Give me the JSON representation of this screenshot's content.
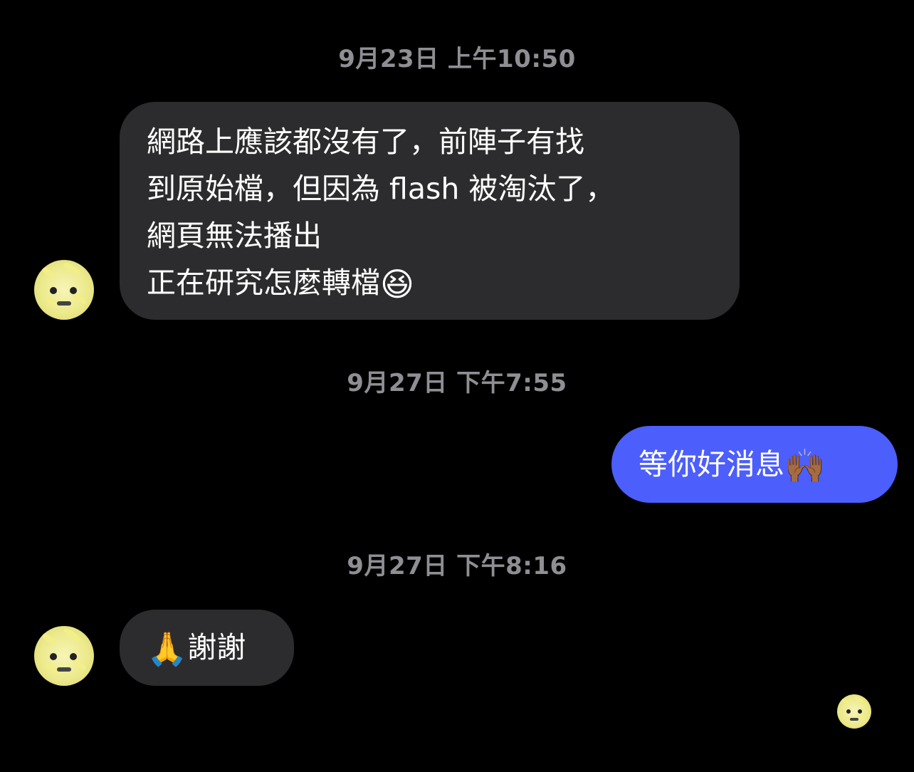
{
  "conversation": {
    "ts1": "9月23日 上午10:50",
    "msg1": {
      "lines": [
        "網路上應該都沒有了，前陣子有找",
        "到原始檔，但因為 flash 被淘汰了，",
        "網頁無法播出",
        "正在研究怎麼轉檔"
      ],
      "emoji": "😆"
    },
    "ts2": "9月27日 下午7:55",
    "msg2": {
      "text": "等你好消息",
      "emoji": "🙌🏾"
    },
    "ts3": "9月27日 下午8:16",
    "msg3": {
      "emoji": "🙏",
      "text": "謝謝"
    }
  },
  "icons": {
    "contact_avatar": "contact-avatar-icon",
    "read_receipt": "read-receipt-avatar-icon"
  }
}
